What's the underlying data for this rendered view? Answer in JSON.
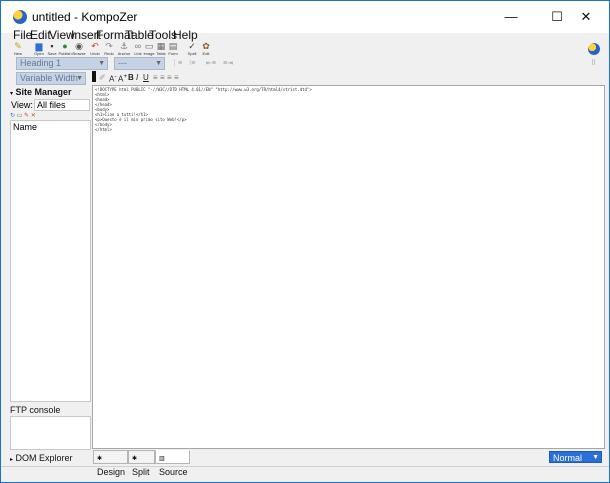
{
  "window": {
    "title": "untitled - KompoZer",
    "controls": {
      "minimize": "—",
      "maximize": "☐",
      "close": "✕"
    }
  },
  "menubar": [
    "File",
    "Edit",
    "View",
    "Insert",
    "Format",
    "Table",
    "Tools",
    "Help"
  ],
  "toolbar": [
    {
      "label": "New",
      "icon": "new-page-icon"
    },
    {
      "label": "Open",
      "icon": "open-folder-icon"
    },
    {
      "label": "Save",
      "icon": "save-icon"
    },
    {
      "label": "Publish",
      "icon": "publish-icon"
    },
    {
      "label": "Browse",
      "icon": "browse-icon"
    },
    {
      "label": "Undo",
      "icon": "undo-icon"
    },
    {
      "label": "Redo",
      "icon": "redo-icon"
    },
    {
      "label": "Anchor",
      "icon": "anchor-icon"
    },
    {
      "label": "Link",
      "icon": "link-icon"
    },
    {
      "label": "Image",
      "icon": "image-icon"
    },
    {
      "label": "Table",
      "icon": "table-icon"
    },
    {
      "label": "Form",
      "icon": "form-icon"
    },
    {
      "label": "Spell",
      "icon": "spell-icon"
    },
    {
      "label": "Edit",
      "icon": "edit-icon"
    }
  ],
  "format": {
    "paragraph_style": "Heading 1",
    "font": "---",
    "width": "Variable Width"
  },
  "sidebar": {
    "site_manager_title": "Site Manager",
    "view_label": "View:",
    "view_value": "All files",
    "name_header": "Name",
    "ftp_console": "FTP console",
    "dom_explorer": "DOM Explorer"
  },
  "source_lines": [
    "<!DOCTYPE html PUBLIC \"-//W3C//DTD HTML 4.01//EN\" \"http://www.w3.org/TR/html4/strict.dtd\">",
    "<html>",
    "<head>",
    "</head>",
    "<body>",
    "<h1>Ciao a tutti!</h1>",
    "<p>Questo è il mio primo sito Web!</p>",
    "</body>",
    "</html>"
  ],
  "tabs": [
    "Design",
    "Split",
    "Source"
  ],
  "view_mode": "Normal"
}
